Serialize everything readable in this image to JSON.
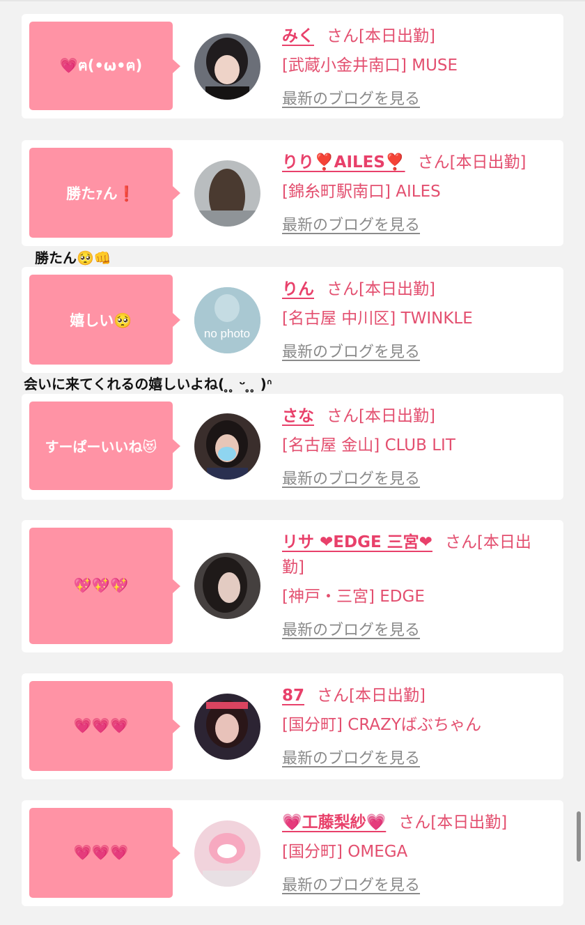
{
  "entries": [
    {
      "bubble": "💗ฅ(•ω•ฅ)",
      "name": "みく",
      "suffix": "さん[本日出勤]",
      "shop": "[武蔵小金井南口] MUSE",
      "blog": "最新のブログを見る"
    },
    {
      "bubble": "勝たｧん❗️",
      "name": "りり❣️AILES❣️",
      "suffix": "さん[本日出勤]",
      "shop": "[錦糸町駅南口] AILES",
      "blog": "最新のブログを見る"
    },
    {
      "bubble": "嬉しい🥺",
      "name": "りん",
      "suffix": "さん[本日出勤]",
      "shop": "[名古屋 中川区] TWINKLE",
      "blog": "最新のブログを見る",
      "avatar_text": "no photo"
    },
    {
      "bubble": "すーぱーいいね😻",
      "name": "さな",
      "suffix": "さん[本日出勤]",
      "shop": "[名古屋 金山] CLUB LIT",
      "blog": "最新のブログを見る"
    },
    {
      "bubble": "💖💖💖",
      "name": "リサ ❤EDGE 三宮❤",
      "suffix": "さん[本日出勤]",
      "shop": "[神戸・三宮] EDGE",
      "blog": "最新のブログを見る"
    },
    {
      "bubble": "💗💗💗",
      "name": "87",
      "suffix": "さん[本日出勤]",
      "shop": "[国分町] CRAZYばぶちゃん",
      "blog": "最新のブログを見る"
    },
    {
      "bubble": "💗💗💗",
      "name": "💗工藤梨紗💗",
      "suffix": "さん[本日出勤]",
      "shop": "[国分町] OMEGA",
      "blog": "最新のブログを見る"
    }
  ],
  "comments": {
    "first": "勝たん🥺👊",
    "second": "会いに来てくれるの嬉しいよね( ̥ ̥ ᵕ ̥ ̥ )ᐢ"
  },
  "colors": {
    "bubble": "#ff93a5",
    "name": "#e8406a",
    "text": "#e34f6f",
    "blog_link": "#8a8a8a",
    "background": "#f2f2f2"
  }
}
